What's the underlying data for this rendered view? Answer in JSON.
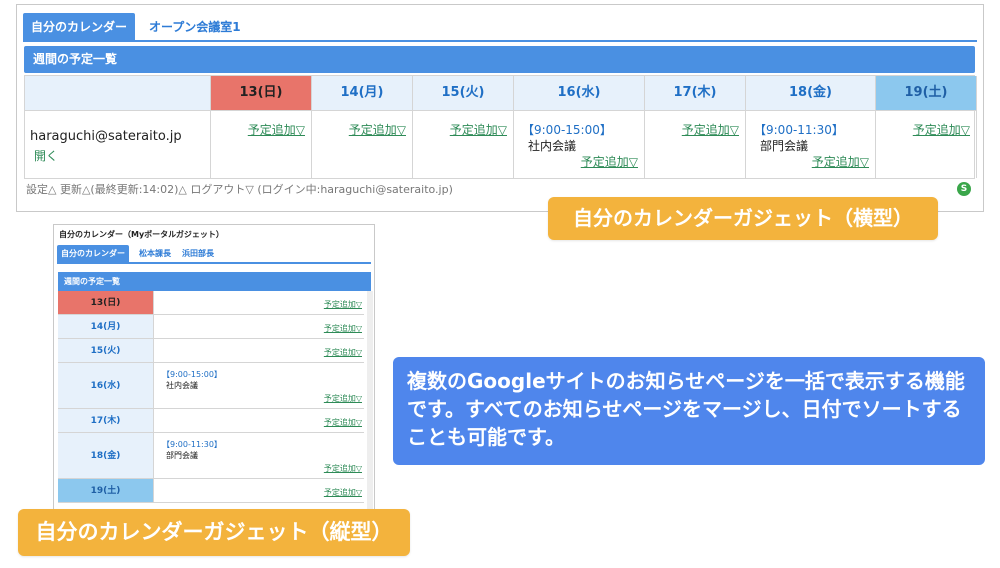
{
  "horizontal": {
    "tabs": [
      "自分のカレンダー",
      "オープン会議室1"
    ],
    "bar_title": "週間の予定一覧",
    "user_email": "haraguchi@sateraito.jp",
    "user_open": "開く",
    "add_label": "予定追加▽",
    "days": [
      {
        "label": "13(日)",
        "type": "sun"
      },
      {
        "label": "14(月)",
        "type": "weekday"
      },
      {
        "label": "15(火)",
        "type": "weekday"
      },
      {
        "label": "16(水)",
        "type": "weekday",
        "event_time": "【9:00-15:00】",
        "event_title": "社内会議"
      },
      {
        "label": "17(木)",
        "type": "weekday"
      },
      {
        "label": "18(金)",
        "type": "weekday",
        "event_time": "【9:00-11:30】",
        "event_title": "部門会議"
      },
      {
        "label": "19(土)",
        "type": "sat"
      }
    ],
    "footer": "設定△  更新△(最終更新:14:02)△   ログアウト▽  (ログイン中:haraguchi@sateraito.jp)",
    "badge": "S"
  },
  "label_horizontal": "自分のカレンダーガジェット（横型）",
  "vertical": {
    "title": "自分のカレンダー（Myポータルガジェット）",
    "tabs": [
      "自分のカレンダー",
      "松本課長",
      "浜田部長"
    ],
    "bar_title": "週間の予定一覧",
    "add_label": "予定追加▽",
    "days": [
      {
        "label": "13(日)",
        "type": "sun"
      },
      {
        "label": "14(月)",
        "type": "weekday"
      },
      {
        "label": "15(火)",
        "type": "weekday"
      },
      {
        "label": "16(水)",
        "type": "weekday",
        "event_time": "【9:00-15:00】",
        "event_title": "社内会議"
      },
      {
        "label": "17(木)",
        "type": "weekday"
      },
      {
        "label": "18(金)",
        "type": "weekday",
        "event_time": "【9:00-11:30】",
        "event_title": "部門会議"
      },
      {
        "label": "19(土)",
        "type": "sat"
      }
    ]
  },
  "label_vertical": "自分のカレンダーガジェット（縦型）",
  "callout": "複数のGoogleサイトのお知らせページを一括で表示する機能です。すべてのお知らせページをマージし、日付でソートすることも可能です。"
}
